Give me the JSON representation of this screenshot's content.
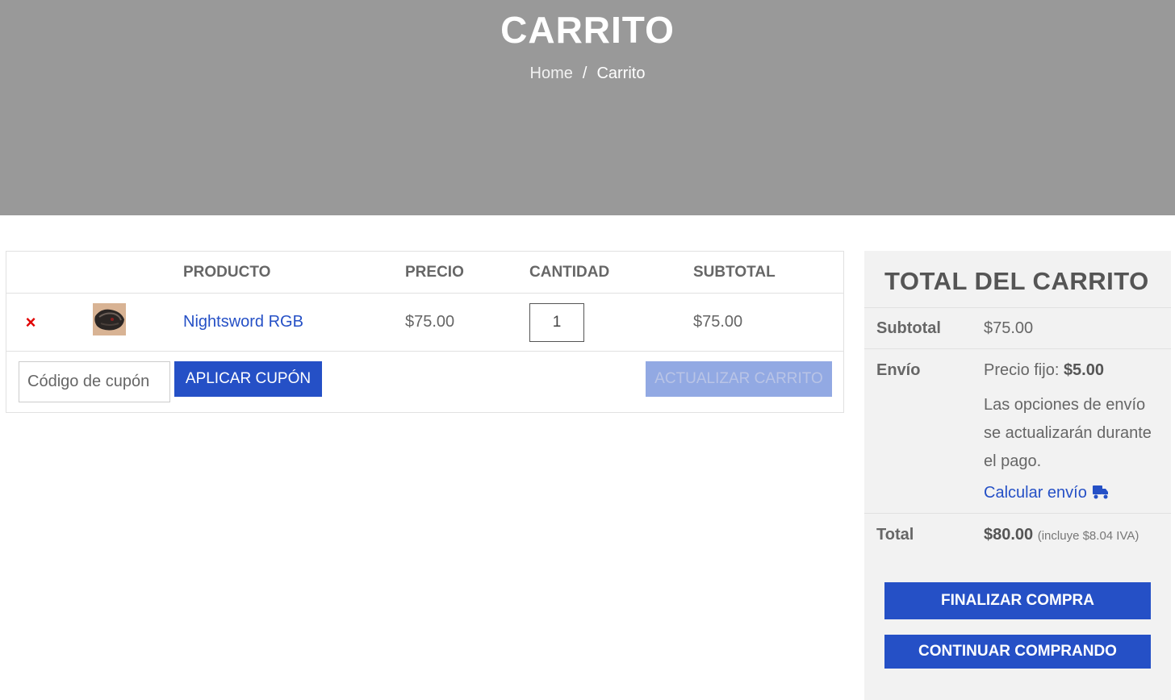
{
  "hero": {
    "title": "CARRITO",
    "breadcrumb": {
      "home": "Home",
      "separator": "/",
      "current": "Carrito"
    }
  },
  "cart": {
    "columns": {
      "product": "PRODUCTO",
      "price": "PRECIO",
      "quantity": "CANTIDAD",
      "subtotal": "SUBTOTAL"
    },
    "item": {
      "remove_icon": "close-icon",
      "remove_symbol": "×",
      "name": "Nightsword RGB",
      "price": "$75.00",
      "quantity": "1",
      "subtotal": "$75.00"
    },
    "coupon": {
      "placeholder": "Código de cupón",
      "apply_label": "APLICAR CUPÓN"
    },
    "update_label": "ACTUALIZAR CARRITO"
  },
  "totals": {
    "title": "TOTAL DEL CARRITO",
    "subtotal_label": "Subtotal",
    "subtotal_value": "$75.00",
    "shipping_label": "Envío",
    "shipping_fixed_label": "Precio fijo:",
    "shipping_fixed_value": "$5.00",
    "shipping_note": "Las opciones de envío se actualizarán durante el pago.",
    "calculate_label": "Calcular envío",
    "calculate_icon": "truck-icon",
    "total_label": "Total",
    "total_value": "$80.00",
    "total_tax": "(incluye $8.04 IVA)",
    "checkout_label": "FINALIZAR COMPRA",
    "continue_label": "CONTINUAR COMPRANDO"
  },
  "colors": {
    "accent": "#2550c6",
    "hero_bg": "#999999",
    "remove": "#e10000",
    "disabled_button": "#92a9e3",
    "totals_bg": "#f2f2f2"
  }
}
